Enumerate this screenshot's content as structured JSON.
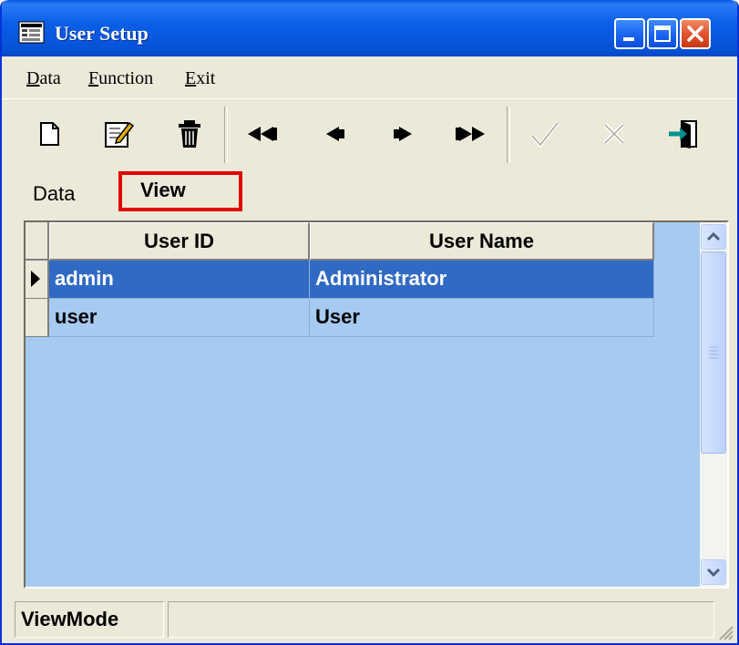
{
  "window": {
    "title": "User Setup",
    "icons": {
      "app": "app-window-icon",
      "minimize": "minimize-icon",
      "maximize": "maximize-icon",
      "close": "close-icon"
    }
  },
  "menu": {
    "items": [
      {
        "label": "Data",
        "accel": "D"
      },
      {
        "label": "Function",
        "accel": "F"
      },
      {
        "label": "Exit",
        "accel": "E"
      }
    ]
  },
  "toolbar": {
    "tools": [
      "new-icon",
      "edit-icon",
      "delete-icon",
      "first-record-icon",
      "prev-record-icon",
      "next-record-icon",
      "last-record-icon",
      "confirm-icon",
      "cancel-icon",
      "exit-icon"
    ],
    "disabled": [
      "confirm-icon",
      "cancel-icon"
    ]
  },
  "tabs": [
    {
      "label": "Data",
      "selected": false
    },
    {
      "label": "View",
      "selected": true
    }
  ],
  "grid": {
    "columns": [
      "User ID",
      "User Name"
    ],
    "rows": [
      {
        "id": "admin",
        "name": "Administrator",
        "selected": true
      },
      {
        "id": "user",
        "name": "User",
        "selected": false
      }
    ]
  },
  "status": {
    "mode": "ViewMode"
  },
  "colors": {
    "title_bar": "#0b5fe8",
    "selection": "#316ac5",
    "grid_background": "#a6caf0",
    "highlight_box": "#e00000"
  }
}
